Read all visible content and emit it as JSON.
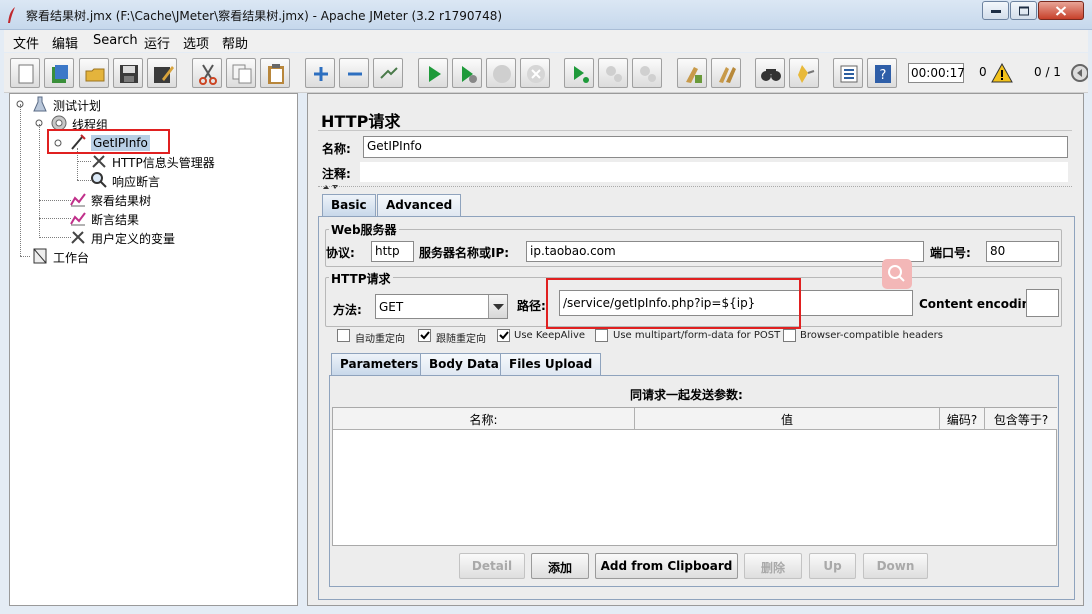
{
  "window": {
    "title": "察看结果树.jmx (F:\\Cache\\JMeter\\察看结果树.jmx) - Apache JMeter (3.2 r1790748)"
  },
  "menu": [
    "文件",
    "编辑",
    "Search",
    "运行",
    "选项",
    "帮助"
  ],
  "toolbar": {
    "icons": [
      "new-icon",
      "templates-icon",
      "open-icon",
      "save-icon",
      "save-as-icon",
      "cut-icon",
      "copy-icon",
      "paste-icon",
      "expand-icon",
      "collapse-icon",
      "toggle-icon",
      "start-icon",
      "start-no-pause-icon",
      "stop-icon",
      "shutdown-icon",
      "remote-start-icon",
      "remote-stop-icon",
      "remote-shutdown-icon",
      "clear-icon",
      "clear-all-icon",
      "search-icon",
      "reset-search-icon",
      "function-helper-icon",
      "help-icon"
    ],
    "timer": "00:00:17",
    "warning_count": "0",
    "threads": "0 / 1"
  },
  "tree": {
    "items": [
      {
        "label": "测试计划",
        "icon": "test-plan-icon"
      },
      {
        "label": "线程组",
        "icon": "thread-group-icon"
      },
      {
        "label": "GetIPInfo",
        "icon": "http-sampler-icon"
      },
      {
        "label": "HTTP信息头管理器",
        "icon": "header-manager-icon"
      },
      {
        "label": "响应断言",
        "icon": "assertion-icon"
      },
      {
        "label": "察看结果树",
        "icon": "listener-icon"
      },
      {
        "label": "断言结果",
        "icon": "listener-icon"
      },
      {
        "label": "用户定义的变量",
        "icon": "config-icon"
      },
      {
        "label": "工作台",
        "icon": "workbench-icon"
      }
    ]
  },
  "panel": {
    "title": "HTTP请求",
    "name_label": "名称:",
    "name_value": "GetIPInfo",
    "comment_label": "注释:",
    "comment_value": "",
    "tabs": [
      "Basic",
      "Advanced"
    ],
    "web_server": {
      "title": "Web服务器",
      "protocol_label": "协议:",
      "protocol_value": "http",
      "server_label": "服务器名称或IP:",
      "server_value": "ip.taobao.com",
      "port_label": "端口号:",
      "port_value": "80"
    },
    "http_request": {
      "title": "HTTP请求",
      "method_label": "方法:",
      "method_value": "GET",
      "path_label": "路径:",
      "path_value": "/service/getIpInfo.php?ip=${ip}",
      "encoding_label": "Content encoding:",
      "encoding_value": ""
    },
    "checkboxes": [
      {
        "label": "自动重定向",
        "checked": false
      },
      {
        "label": "跟随重定向",
        "checked": true
      },
      {
        "label": "Use KeepAlive",
        "checked": true
      },
      {
        "label": "Use multipart/form-data for POST",
        "checked": false
      },
      {
        "label": "Browser-compatible headers",
        "checked": false
      }
    ],
    "param_tabs": [
      "Parameters",
      "Body Data",
      "Files Upload"
    ],
    "params_caption": "同请求一起发送参数:",
    "columns": [
      "名称:",
      "值",
      "编码?",
      "包含等于?"
    ],
    "buttons": [
      {
        "label": "Detail",
        "enabled": false
      },
      {
        "label": "添加",
        "enabled": true
      },
      {
        "label": "Add from Clipboard",
        "enabled": true
      },
      {
        "label": "删除",
        "enabled": false
      },
      {
        "label": "Up",
        "enabled": false
      },
      {
        "label": "Down",
        "enabled": false
      }
    ]
  }
}
